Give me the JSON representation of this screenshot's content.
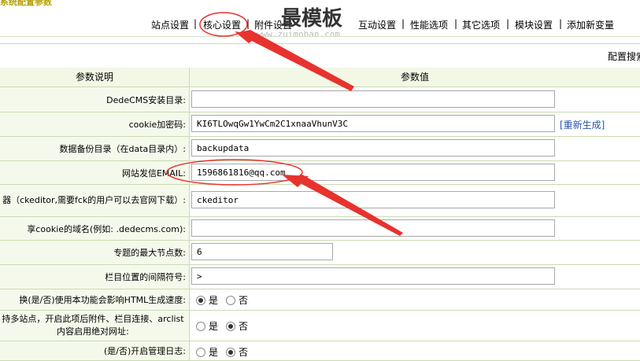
{
  "header": {
    "title": "系统配置参数"
  },
  "watermark": {
    "logo": "最模板",
    "url": "www.zuimoban.com"
  },
  "tabs": [
    {
      "label": "站点设置"
    },
    {
      "label": "核心设置"
    },
    {
      "label": "附件设置"
    },
    {
      "label": "互动设置"
    },
    {
      "label": "性能选项"
    },
    {
      "label": "其它选项"
    },
    {
      "label": "模块设置"
    },
    {
      "label": "添加新变量"
    }
  ],
  "config_bar": {
    "label": "配置搜索"
  },
  "table": {
    "head": {
      "desc": "参数说明",
      "value": "参数值"
    },
    "rows": [
      {
        "label": "DedeCMS安装目录:",
        "value": ""
      },
      {
        "label": "cookie加密码:",
        "value": "KI6TLOwqGw1YwCm2C1xnaaVhunV3C",
        "link": "[重新生成]"
      },
      {
        "label": "数据备份目录（在data目录内）:",
        "value": "backupdata"
      },
      {
        "label": "网站发信EMAIL:",
        "value": "1596861816@qq.com"
      },
      {
        "label": "器（ckeditor,需要fck的用户可以去官网下载）:",
        "value": "ckeditor"
      },
      {
        "label": "享cookie的域名(例如: .dedecms.com):",
        "value": ""
      },
      {
        "label": "专题的最大节点数:",
        "value": "6"
      },
      {
        "label": "栏目位置的间隔符号:",
        "value": " > "
      },
      {
        "label": "换(是/否)使用本功能会影响HTML生成速度:",
        "yes": "是",
        "no": "否",
        "selected": "yes"
      },
      {
        "label": "持多站点，开启此项后附件、栏目连接、arclist内容启用绝对网址:",
        "yes": "是",
        "no": "否",
        "selected": "no"
      },
      {
        "label": "(是/否)开启管理日志:",
        "yes": "是",
        "no": "否",
        "selected": "no"
      }
    ]
  },
  "colors": {
    "annotation": "#e8322e",
    "link": "#2b57a5",
    "header_bg": "#f3f7e6",
    "border": "#c9dbb0"
  }
}
